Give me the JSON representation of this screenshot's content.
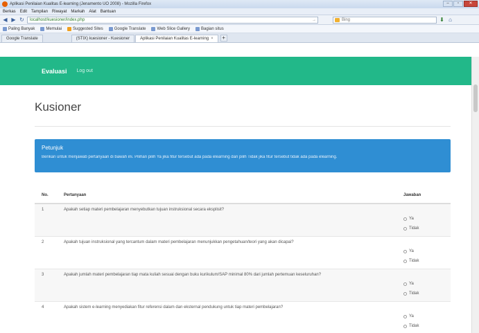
{
  "browser": {
    "window_title": "Aplikasi Penilaian Kualitas E-learning (Jenamento UO 2008) - Mozilla Firefox",
    "menu": [
      "Berkas",
      "Edit",
      "Tampilan",
      "Riwayat",
      "Markah",
      "Alat",
      "Bantuan"
    ],
    "url": "localhost/kuesioner/index.php",
    "search_placeholder": "Bing",
    "bookmarks": [
      "Paling Banyak",
      "Memulai",
      "Suggested Sites",
      "Google Translate",
      "Web Slice Gallery",
      "Bagian situs"
    ],
    "tabs": [
      {
        "label": "Google Translate",
        "active": false
      },
      {
        "label": "(STIX) kuesioner - Kuesioner",
        "active": false
      },
      {
        "label": "Aplikasi Penilaian Kualitas E-learning",
        "active": true
      }
    ]
  },
  "app": {
    "brand": "Evaluasi",
    "nav_link": "Log out",
    "accent": "#22b889"
  },
  "page": {
    "title": "Kusioner",
    "info_heading": "Petunjuk",
    "info_text": "Berikan untuk menjawab pertanyaan di bawah ini. Pilihan pilih Ya jika fitur tersebut ada pada elearning dan pilih Tidak jika fitur tersebut tidak ada pada elearning."
  },
  "table": {
    "headers": {
      "no": "No.",
      "question": "Pertanyaan",
      "answer": "Jawaban"
    },
    "option_yes": "Ya",
    "option_no": "Tidak",
    "rows": [
      {
        "no": "1",
        "question": "Apakah setiap materi pembelajaran menyebutkan tujuan instruksional secara eksplisit?"
      },
      {
        "no": "2",
        "question": "Apakah tujuan instruksional yang tercantum dalam materi pembelajaran menunjukkan pengetahuan/teori yang akan dicapai?"
      },
      {
        "no": "3",
        "question": "Apakah jumlah materi pembelajaran tiap mata kuliah sesuai dengan buku kurikulum/SAP minimal 80% dari jumlah pertemuan keseluruhan?"
      },
      {
        "no": "4",
        "question": "Apakah sistem e-learning menyediakan fitur referensi dalam dan eksternal pendukung untuk tiap materi pembelajaran?"
      }
    ]
  }
}
